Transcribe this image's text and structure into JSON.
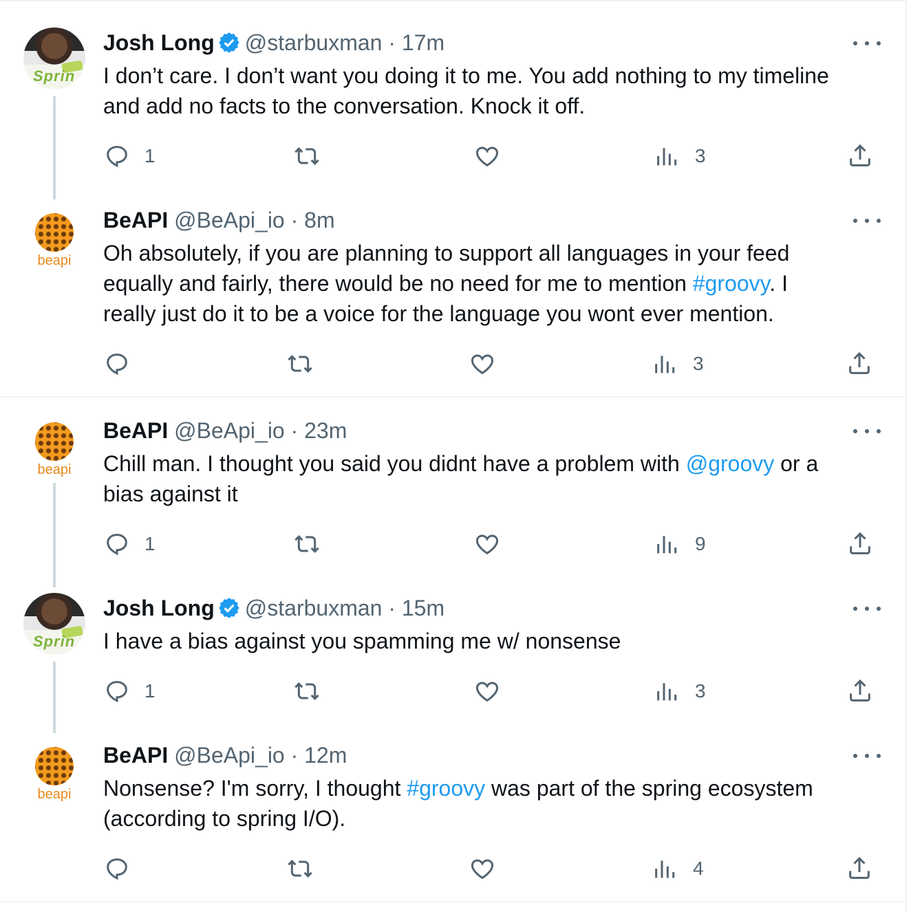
{
  "tweets": [
    {
      "author": "Josh Long",
      "verified": true,
      "handle": "@starbuxman · 17m",
      "text": [
        "I don’t care. I don’t want you doing it to me. You add nothing to my timeline",
        "and add no facts to the conversation. Knock it off."
      ],
      "replies": "1",
      "retweets": "",
      "likes": "",
      "views": "3"
    },
    {
      "author": "BeAPI",
      "verified": false,
      "handle": "@BeApi_io · 8m",
      "line1": "Oh absolutely, if you are planning to support all languages in your feed",
      "line2_before": "equally and fairly, there would be no need for me to mention ",
      "line2_link": "#groovy",
      "line2_after": ". I",
      "line3": "really just do it to be a voice for the language you wont ever mention.",
      "replies": "",
      "retweets": "",
      "likes": "",
      "views": "3"
    },
    {
      "author": "BeAPI",
      "verified": false,
      "handle": "@BeApi_io · 23m",
      "line1_before": "Chill man. I thought you said you didnt have a problem with ",
      "line1_link": "@groovy",
      "line1_after": " or a",
      "line2": "bias against it",
      "replies": "1",
      "retweets": "",
      "likes": "",
      "views": "9"
    },
    {
      "author": "Josh Long",
      "verified": true,
      "handle": "@starbuxman · 15m",
      "line1": "I have a bias against you spamming me w/ nonsense",
      "replies": "1",
      "retweets": "",
      "likes": "",
      "views": "3"
    },
    {
      "author": "BeAPI",
      "verified": false,
      "handle": "@BeApi_io · 12m",
      "line1_before": "Nonsense? I'm sorry, I thought ",
      "line1_link": "#groovy",
      "line1_after": " was part of the spring ecosystem",
      "line2": "(according to spring I/O).",
      "replies": "",
      "retweets": "",
      "likes": "",
      "views": "4"
    }
  ],
  "avatars": {
    "josh_tag": "Sprin",
    "beapi_word": "beapi"
  },
  "colors": {
    "link": "#1d9bf0",
    "secondary": "#536471",
    "verified": "#1d9bf0",
    "beapi_orange": "#f39a1e"
  },
  "icons": [
    "reply-icon",
    "retweet-icon",
    "like-icon",
    "views-icon",
    "share-icon",
    "more-icon",
    "verified-badge-icon"
  ]
}
